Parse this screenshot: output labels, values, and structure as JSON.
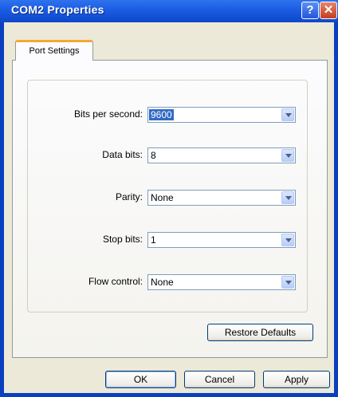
{
  "window": {
    "title": "COM2 Properties",
    "help_glyph": "?",
    "close_glyph": "✕"
  },
  "tabs": [
    {
      "label": "Port Settings",
      "active": true
    }
  ],
  "settings": [
    {
      "label": "Bits per second:",
      "value": "9600",
      "selected": true
    },
    {
      "label": "Data bits:",
      "value": "8"
    },
    {
      "label": "Parity:",
      "value": "None"
    },
    {
      "label": "Stop bits:",
      "value": "1"
    },
    {
      "label": "Flow control:",
      "value": "None"
    }
  ],
  "buttons": {
    "restore": "Restore Defaults",
    "ok": "OK",
    "cancel": "Cancel",
    "apply": "Apply"
  },
  "colors": {
    "title_bar": "#1a5ce2",
    "tab_highlight": "#f6a735",
    "selection": "#316ac5",
    "dialog_face": "#ece9d8"
  }
}
